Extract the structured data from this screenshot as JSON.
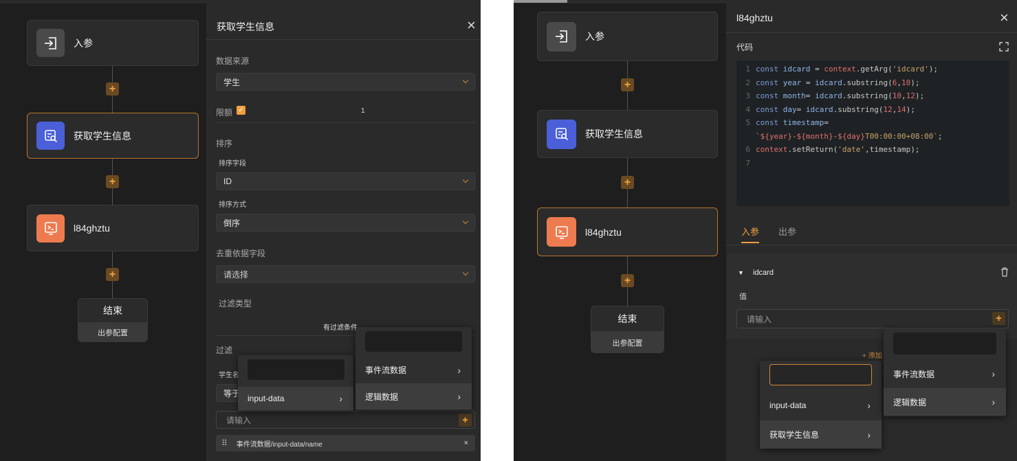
{
  "left_screen": {
    "flow": {
      "nodes": [
        {
          "label": "入参",
          "icon": "input-param-icon"
        },
        {
          "label": "获取学生信息",
          "icon": "query-icon"
        },
        {
          "label": "l84ghztu",
          "icon": "terminal-icon"
        }
      ],
      "end_node": {
        "title": "结束",
        "footer": "出参配置"
      }
    },
    "panel": {
      "title": "获取学生信息",
      "data_source_label": "数据来源",
      "data_source_value": "学生",
      "limit_label": "限额",
      "limit_value": "1",
      "sort_section": "排序",
      "sort_field_label": "排序字段",
      "sort_field_value": "ID",
      "sort_order_label": "排序方式",
      "sort_order_value": "倒序",
      "dedup_label": "去重依据字段",
      "dedup_placeholder": "请选择",
      "filter_type_label": "过滤类型",
      "filter_type_value": "有过滤条件",
      "filter_label": "过滤",
      "filter_field_partial": "学生名",
      "operator_partial": "等于",
      "value_placeholder": "请输入",
      "tag_text": "事件流数据/input-data/name",
      "tag_close": "×"
    },
    "menu_sub": {
      "items": [
        "input-data"
      ]
    },
    "menu_root": {
      "items": [
        "事件流数据",
        "逻辑数据"
      ]
    }
  },
  "right_screen": {
    "flow": {
      "nodes": [
        {
          "label": "入参",
          "icon": "input-param-icon"
        },
        {
          "label": "获取学生信息",
          "icon": "query-icon"
        },
        {
          "label": "l84ghztu",
          "icon": "terminal-icon"
        }
      ],
      "end_node": {
        "title": "结束",
        "footer": "出参配置"
      }
    },
    "panel": {
      "title": "l84ghztu",
      "code_label": "代码",
      "code_lines": [
        "const idcard = context.getArg('idcard');",
        "const year = idcard.substring(6,10);",
        "const month= idcard.substring(10,12);",
        "const day= idcard.substring(12,14);",
        "const timestamp=",
        "`${year}-${month}-${day}T00:00:00+08:00`;",
        "context.setReturn('date',timestamp);",
        ""
      ],
      "line_numbers": [
        "1",
        "2",
        "3",
        "4",
        "5",
        "",
        "6",
        "7"
      ],
      "tabs": [
        "入参",
        "出参"
      ],
      "param_name": "idcard",
      "value_label": "值",
      "value_placeholder": "请输入",
      "add_link": "+ 添加"
    },
    "menu_sub": {
      "items": [
        "input-data",
        "获取学生信息"
      ]
    },
    "menu_root": {
      "items": [
        "事件流数据",
        "逻辑数据"
      ]
    }
  },
  "colors": {
    "accent": "#f0a040",
    "selected_border": "#b8762c",
    "blue_icon": "#4a5fd8",
    "orange_icon": "#ee7b4f"
  }
}
